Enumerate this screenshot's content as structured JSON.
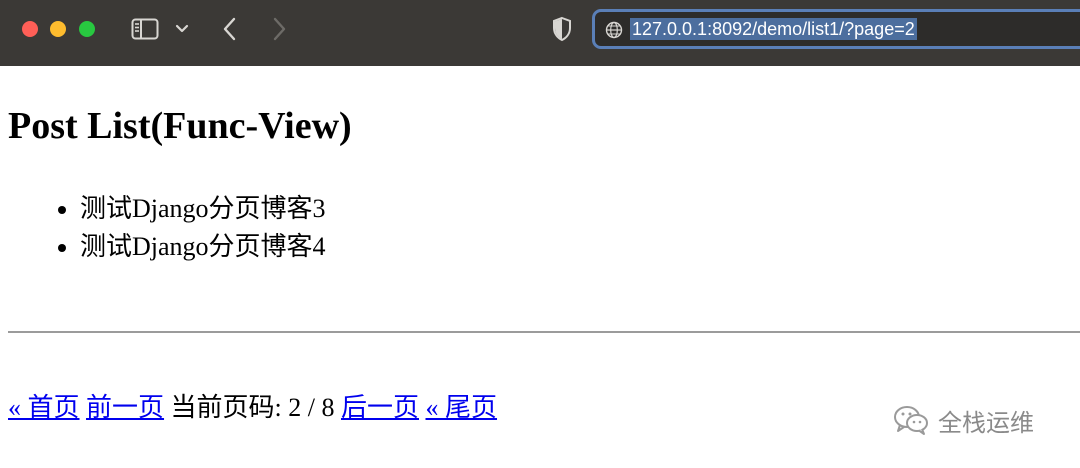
{
  "browser": {
    "url": "127.0.0.1:8092/demo/list1/?page=2",
    "icons": [
      "sidebar-icon",
      "chevron-down-icon",
      "back-icon",
      "forward-icon",
      "shield-icon",
      "globe-icon"
    ]
  },
  "page": {
    "title": "Post List(Func-View)",
    "posts": [
      "测试Django分页博客3",
      "测试Django分页博客4"
    ],
    "pagination": {
      "first": "« 首页",
      "prev": "前一页",
      "current": "当前页码: 2 / 8",
      "next": "后一页",
      "last": "« 尾页"
    }
  },
  "watermark": {
    "text": "全栈运维"
  }
}
